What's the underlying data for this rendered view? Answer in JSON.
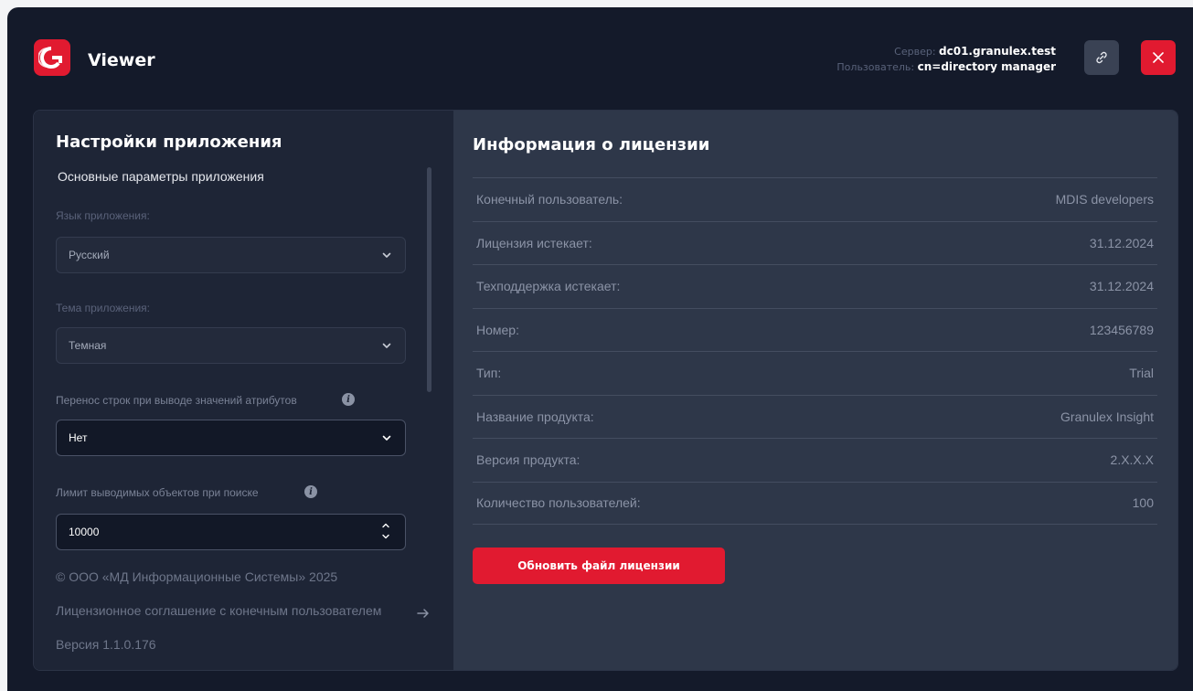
{
  "header": {
    "app_title": "Viewer",
    "server_label": "Сервер:",
    "server_value": "dc01.granulex.test",
    "user_label": "Пользователь:",
    "user_value": "cn=directory manager",
    "link_icon": "link-icon",
    "close_icon": "close-icon"
  },
  "settings": {
    "title": "Настройки приложения",
    "subtitle": "Основные параметры приложения",
    "language_label": "Язык приложения:",
    "language_value": "Русский",
    "theme_label": "Тема приложения:",
    "theme_value": "Темная",
    "wrap_label": "Перенос строк при выводе значений атрибутов",
    "wrap_value": "Нет",
    "limit_label": "Лимит выводимых объектов при поиске",
    "limit_value": "10000",
    "copyright": "© ООО «МД Информационные Системы» 2025",
    "eula_link": "Лицензионное соглашение с конечным пользователем",
    "version": "Версия 1.1.0.176"
  },
  "license": {
    "title": "Информация о лицензии",
    "rows": [
      {
        "key": "Конечный пользователь:",
        "value": "MDIS developers"
      },
      {
        "key": "Лицензия истекает:",
        "value": "31.12.2024"
      },
      {
        "key": "Техподдержка истекает:",
        "value": "31.12.2024"
      },
      {
        "key": "Номер:",
        "value": "123456789"
      },
      {
        "key": "Тип:",
        "value": "Trial"
      },
      {
        "key": "Название продукта:",
        "value": "Granulex Insight"
      },
      {
        "key": "Версия продукта:",
        "value": "2.X.X.X"
      },
      {
        "key": "Количество пользователей:",
        "value": "100"
      }
    ],
    "update_button": "Обновить файл лицензии"
  },
  "colors": {
    "accent": "#e11a30",
    "window_bg": "#141a2a",
    "left_panel_bg": "#1e2536",
    "right_panel_bg": "#2e3749"
  }
}
